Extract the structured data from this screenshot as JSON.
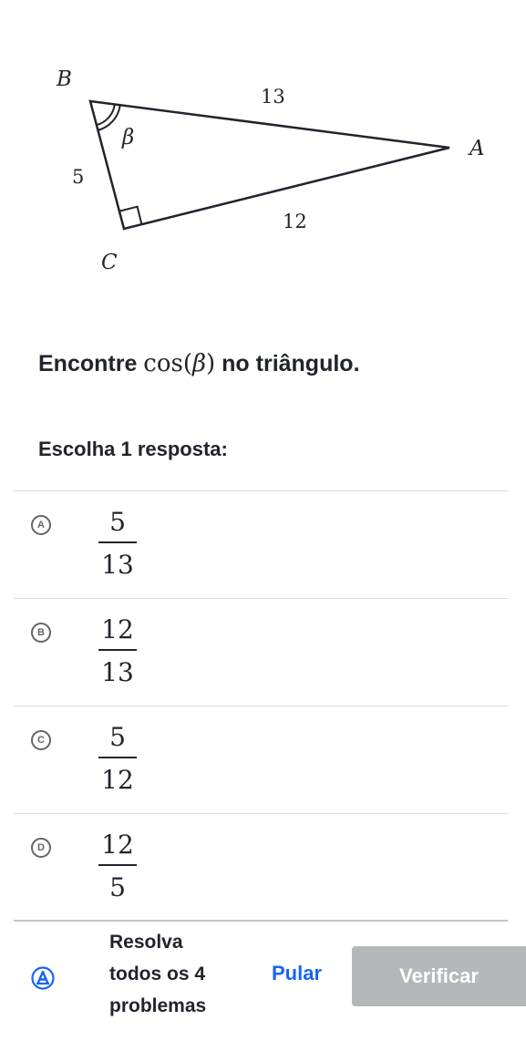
{
  "figure": {
    "vertices": {
      "a": "A",
      "b": "B",
      "c": "C"
    },
    "sides": {
      "ab": "13",
      "bc": "5",
      "ca": "12"
    },
    "angle_label": "β"
  },
  "question": {
    "prefix": "Encontre ",
    "math_fn": "cos",
    "math_open": "(",
    "math_var": "β",
    "math_close": ")",
    "suffix": " no triângulo."
  },
  "prompt": "Escolha 1 resposta:",
  "choices": [
    {
      "letter": "A",
      "numerator": "5",
      "denominator": "13"
    },
    {
      "letter": "B",
      "numerator": "12",
      "denominator": "13"
    },
    {
      "letter": "C",
      "numerator": "5",
      "denominator": "12"
    },
    {
      "letter": "D",
      "numerator": "12",
      "denominator": "5"
    }
  ],
  "footer": {
    "progress_line1": "Resolva",
    "progress_line2": "todos os 4",
    "progress_line3": "problemas",
    "skip_label": "Pular",
    "check_label": "Verificar",
    "icon": "answer-a-badge-icon"
  },
  "colors": {
    "text": "#21242c",
    "link": "#1865f2",
    "button_disabled": "#b6b7b9",
    "divider": "#d6d8da"
  }
}
